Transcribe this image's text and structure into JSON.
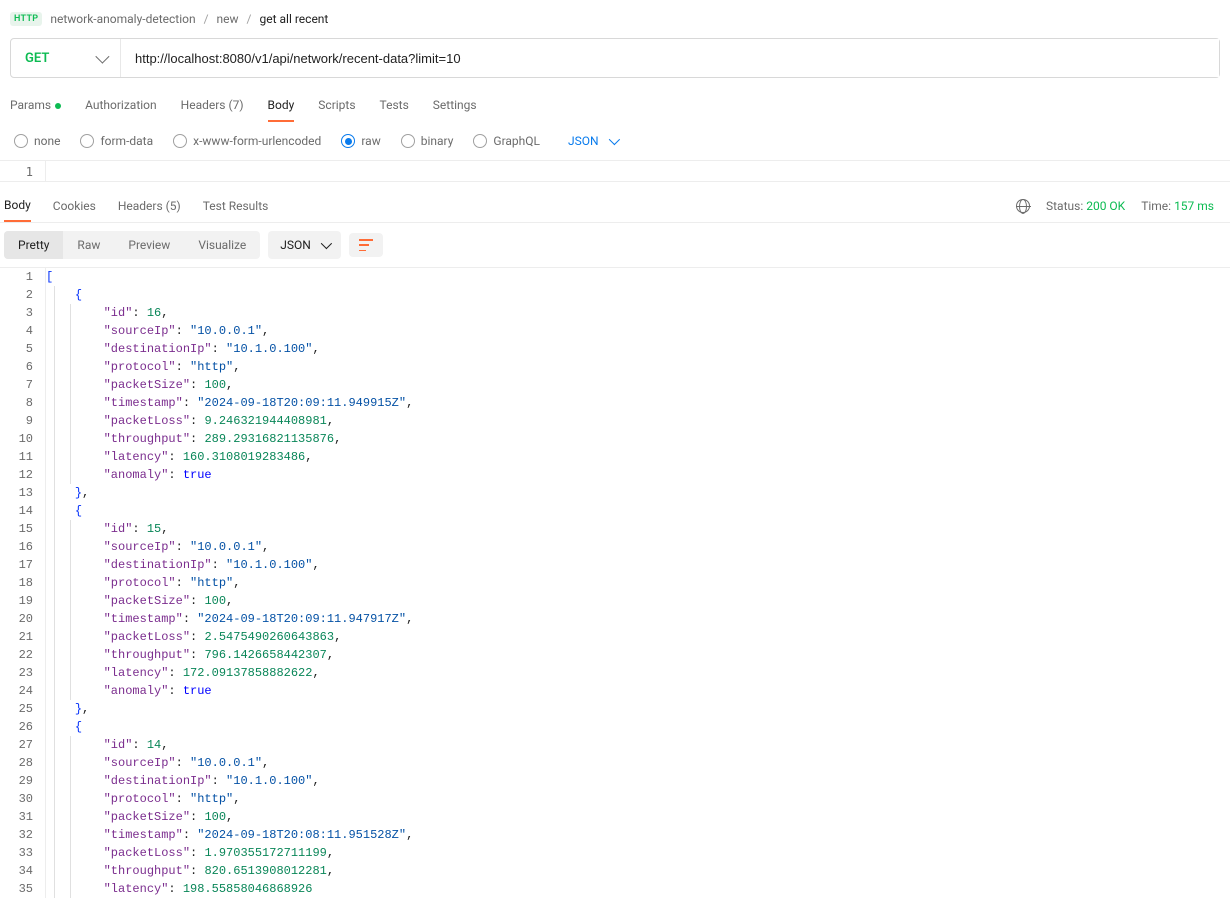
{
  "breadcrumb": {
    "badge": "HTTP",
    "root": "network-anomaly-detection",
    "middle": "new",
    "current": "get all recent"
  },
  "request": {
    "method": "GET",
    "url": "http://localhost:8080/v1/api/network/recent-data?limit=10"
  },
  "req_tabs": {
    "params": "Params",
    "auth": "Authorization",
    "headers": "Headers (7)",
    "body": "Body",
    "scripts": "Scripts",
    "tests": "Tests",
    "settings": "Settings"
  },
  "body_types": {
    "none": "none",
    "form_data": "form-data",
    "x_www": "x-www-form-urlencoded",
    "raw": "raw",
    "binary": "binary",
    "graphql": "GraphQL",
    "raw_format": "JSON"
  },
  "editor_strip_line": "1",
  "resp_tabs": {
    "body": "Body",
    "cookies": "Cookies",
    "headers": "Headers (5)",
    "test_results": "Test Results"
  },
  "status": {
    "label": "Status:",
    "value": "200 OK",
    "time_label": "Time:",
    "time_value": "157 ms"
  },
  "view_modes": {
    "pretty": "Pretty",
    "raw": "Raw",
    "preview": "Preview",
    "visualize": "Visualize",
    "format": "JSON"
  },
  "response_json": [
    {
      "id": 16,
      "sourceIp": "10.0.0.1",
      "destinationIp": "10.1.0.100",
      "protocol": "http",
      "packetSize": 100,
      "timestamp": "2024-09-18T20:09:11.949915Z",
      "packetLoss": 9.246321944408981,
      "throughput": 289.29316821135876,
      "latency": 160.3108019283486,
      "anomaly": true
    },
    {
      "id": 15,
      "sourceIp": "10.0.0.1",
      "destinationIp": "10.1.0.100",
      "protocol": "http",
      "packetSize": 100,
      "timestamp": "2024-09-18T20:09:11.947917Z",
      "packetLoss": 2.5475490260643863,
      "throughput": 796.1426658442307,
      "latency": 172.09137858882622,
      "anomaly": true
    },
    {
      "id": 14,
      "sourceIp": "10.0.0.1",
      "destinationIp": "10.1.0.100",
      "protocol": "http",
      "packetSize": 100,
      "timestamp": "2024-09-18T20:08:11.951528Z",
      "packetLoss": 1.970355172711199,
      "throughput": 820.6513908012281,
      "latency": 198.55858046868926
    }
  ]
}
